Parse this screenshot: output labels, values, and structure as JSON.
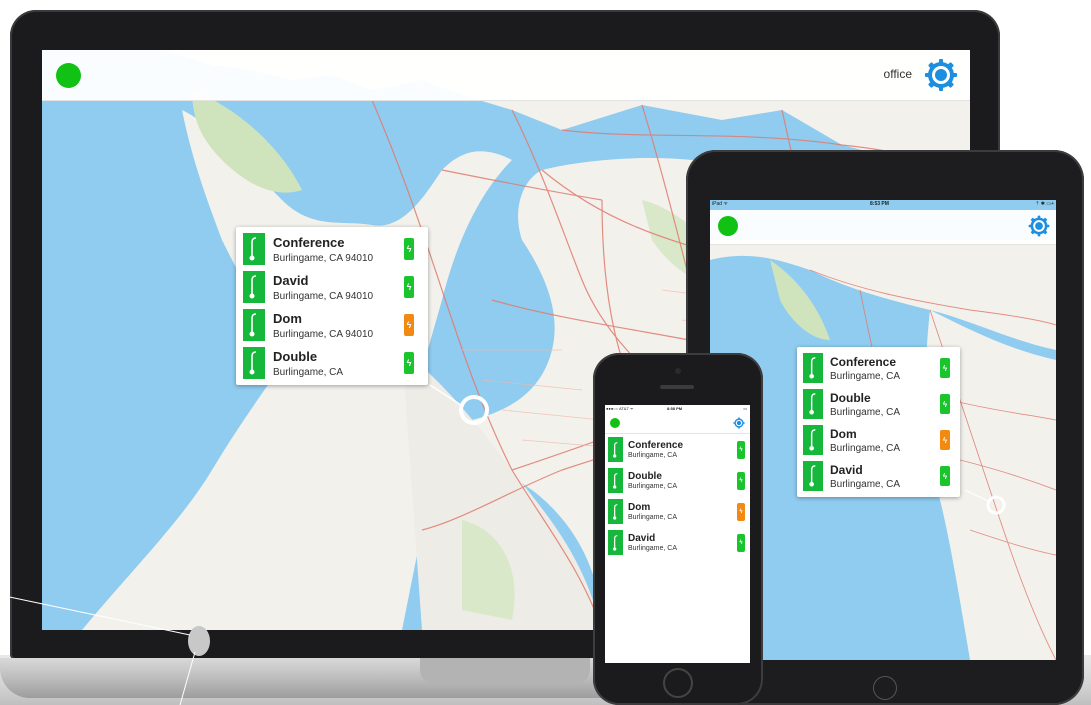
{
  "colors": {
    "accent_green": "#11c113",
    "device_icon_green": "#15b83a",
    "battery_green": "#19c42c",
    "battery_orange": "#f28a12",
    "gear_blue": "#1e8fe0",
    "water": "#8fccef",
    "land": "#f3f1ec"
  },
  "laptop": {
    "appbar": {
      "status_icon": "green-status-dot",
      "location_label": "office",
      "settings_icon": "gear-icon"
    },
    "devices": [
      {
        "name": "Conference",
        "location": "Burlingame, CA 94010",
        "battery": "green"
      },
      {
        "name": "David",
        "location": "Burlingame, CA 94010",
        "battery": "green"
      },
      {
        "name": "Dom",
        "location": "Burlingame, CA 94010",
        "battery": "orange"
      },
      {
        "name": "Double",
        "location": "Burlingame, CA",
        "battery": "green"
      }
    ]
  },
  "ipad": {
    "status_bar": {
      "left": "iPad ᯤ",
      "time": "8:53 PM",
      "right": "⇡ ✱ ▭+"
    },
    "appbar": {
      "status_icon": "green-status-dot",
      "settings_icon": "gear-icon"
    },
    "devices": [
      {
        "name": "Conference",
        "location": "Burlingame, CA",
        "battery": "green"
      },
      {
        "name": "Double",
        "location": "Burlingame, CA",
        "battery": "green"
      },
      {
        "name": "Dom",
        "location": "Burlingame, CA",
        "battery": "orange"
      },
      {
        "name": "David",
        "location": "Burlingame, CA",
        "battery": "green"
      }
    ]
  },
  "iphone": {
    "status_bar": {
      "left": "●●●○○ AT&T ᯤ",
      "time": "8:58 PM",
      "right": "▭"
    },
    "appbar": {
      "status_icon": "green-status-dot",
      "settings_icon": "gear-icon"
    },
    "devices": [
      {
        "name": "Conference",
        "location": "Burlingame, CA",
        "battery": "green"
      },
      {
        "name": "Double",
        "location": "Burlingame, CA",
        "battery": "green"
      },
      {
        "name": "Dom",
        "location": "Burlingame, CA",
        "battery": "orange"
      },
      {
        "name": "David",
        "location": "Burlingame, CA",
        "battery": "green"
      }
    ]
  }
}
